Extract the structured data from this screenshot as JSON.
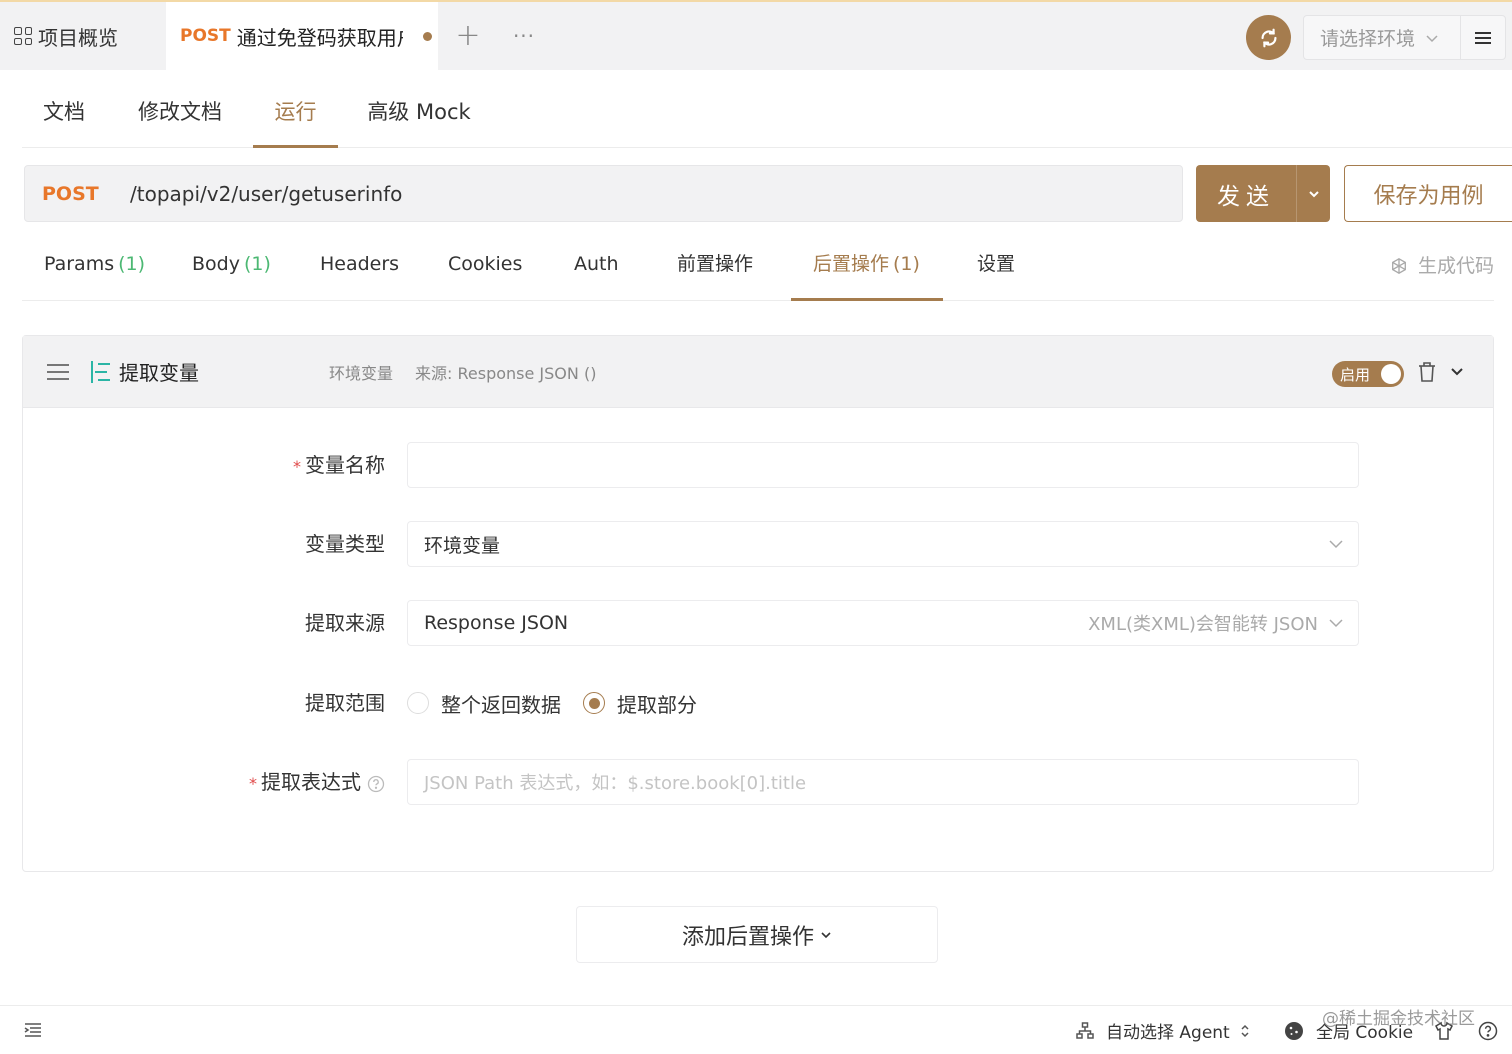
{
  "tabbar": {
    "overview_label": "项目概览",
    "active_tab": {
      "method": "POST",
      "title": "通过免登码获取用户信息"
    },
    "env_placeholder": "请选择环境"
  },
  "doc_tabs": [
    {
      "label": "文档"
    },
    {
      "label": "修改文档"
    },
    {
      "label": "运行",
      "active": true
    },
    {
      "label": "高级 Mock"
    }
  ],
  "request": {
    "method": "POST",
    "path": "/topapi/v2/user/getuserinfo",
    "send_label": "发送",
    "save_label": "保存为用例"
  },
  "req_tabs": [
    {
      "label": "Params",
      "count": "(1)"
    },
    {
      "label": "Body",
      "count": "(1)"
    },
    {
      "label": "Headers",
      "count": ""
    },
    {
      "label": "Cookies",
      "count": ""
    },
    {
      "label": "Auth",
      "count": ""
    },
    {
      "label": "前置操作",
      "count": ""
    },
    {
      "label": "后置操作",
      "count": "(1)",
      "active": true
    },
    {
      "label": "设置",
      "count": ""
    }
  ],
  "gen_code_label": "生成代码",
  "post_op": {
    "title": "提取变量",
    "meta_type": "环境变量",
    "meta_source": "来源: Response JSON ()",
    "enabled_label": "启用",
    "enabled": true,
    "fields": {
      "var_name": {
        "label": "变量名称",
        "required": "*",
        "value": ""
      },
      "var_type": {
        "label": "变量类型",
        "value": "环境变量"
      },
      "source": {
        "label": "提取来源",
        "value": "Response JSON",
        "hint": "XML(类XML)会智能转 JSON"
      },
      "range": {
        "label": "提取范围",
        "options": [
          "整个返回数据",
          "提取部分"
        ],
        "selected": "提取部分"
      },
      "expression": {
        "label": "提取表达式",
        "required": "*",
        "placeholder": "JSON Path 表达式，如：$.store.book[0].title"
      }
    }
  },
  "add_post_op_label": "添加后置操作",
  "statusbar": {
    "agent_label": "自动选择 Agent",
    "cookie_label": "全局 Cookie",
    "watermark": "@稀土掘金技术社区"
  },
  "colors": {
    "accent": "#a57c4e",
    "method": "#e8772a",
    "count": "#4cb873",
    "required": "#e04a4a"
  }
}
